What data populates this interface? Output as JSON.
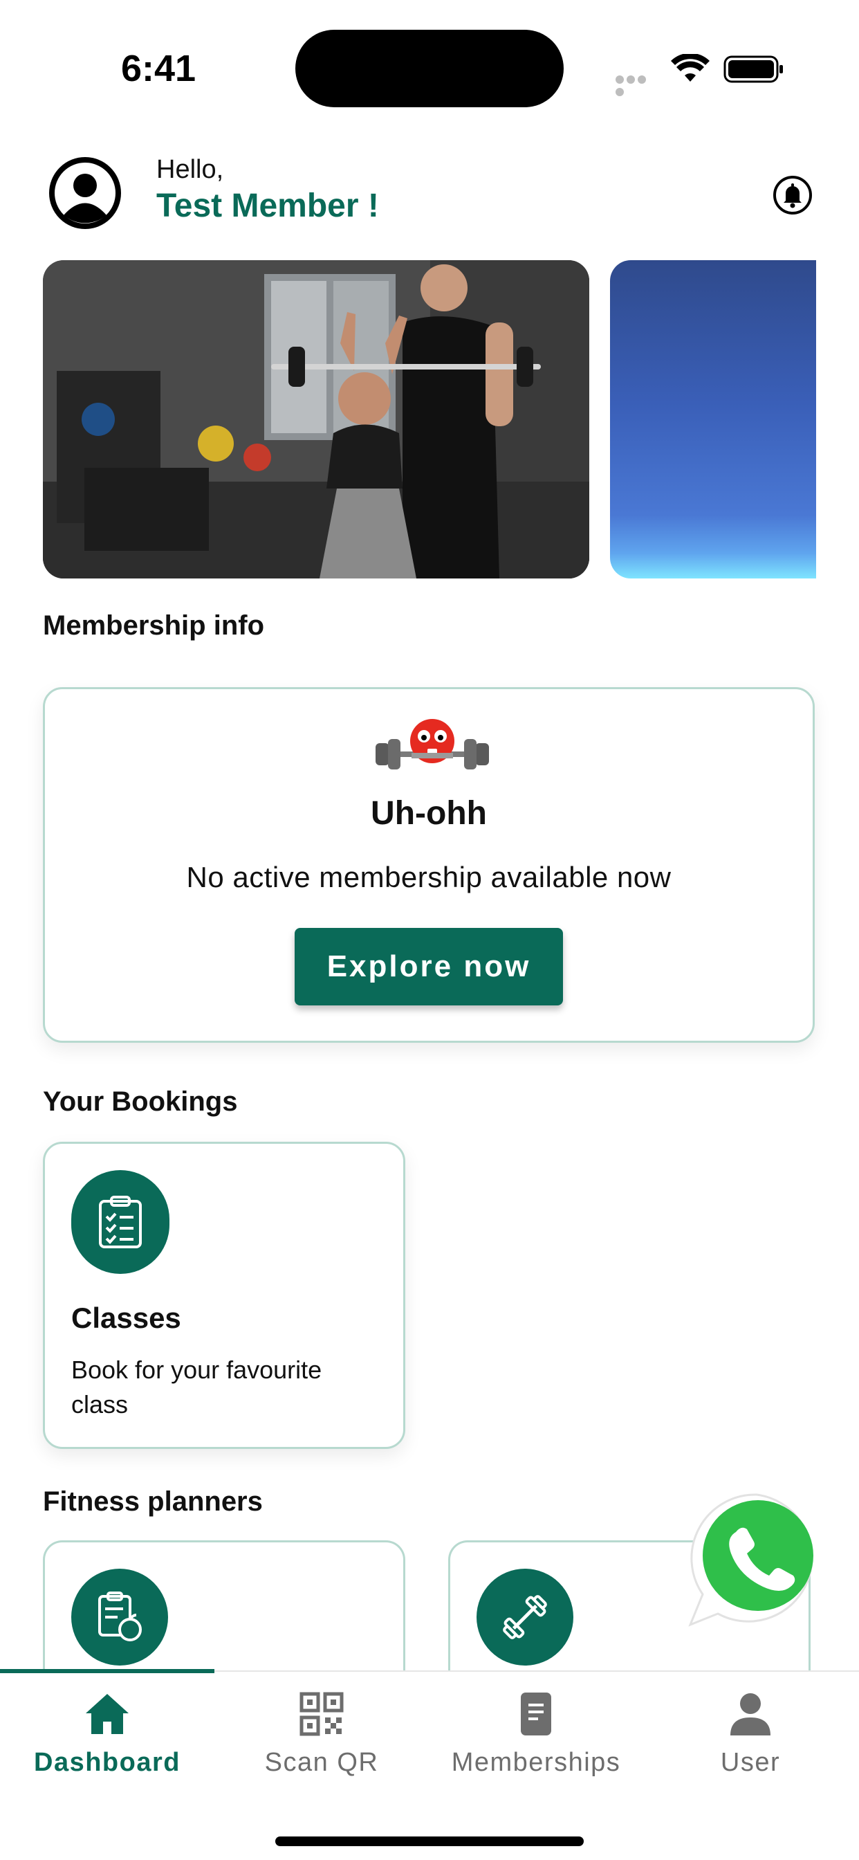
{
  "status_bar": {
    "time": "6:41"
  },
  "header": {
    "greeting": "Hello,",
    "member_name": "Test Member !"
  },
  "membership": {
    "section_title": "Membership info",
    "title": "Uh-ohh",
    "message": "No active membership available now",
    "cta_label": "Explore now"
  },
  "bookings": {
    "section_title": "Your Bookings",
    "cards": [
      {
        "title": "Classes",
        "description": "Book for your favourite class",
        "icon": "clipboard-checklist-icon"
      }
    ]
  },
  "planners": {
    "section_title": "Fitness planners",
    "cards": [
      {
        "icon": "diet-plan-icon"
      },
      {
        "icon": "dumbbell-icon"
      }
    ]
  },
  "bottom_nav": {
    "items": [
      {
        "label": "Dashboard",
        "icon": "home-icon",
        "active": true
      },
      {
        "label": "Scan QR",
        "icon": "qr-code-icon",
        "active": false
      },
      {
        "label": "Memberships",
        "icon": "document-icon",
        "active": false
      },
      {
        "label": "User",
        "icon": "user-icon",
        "active": false
      }
    ]
  },
  "colors": {
    "accent": "#0a6a58",
    "card_border": "#b7d9cf",
    "inactive": "#6d6d6d"
  }
}
